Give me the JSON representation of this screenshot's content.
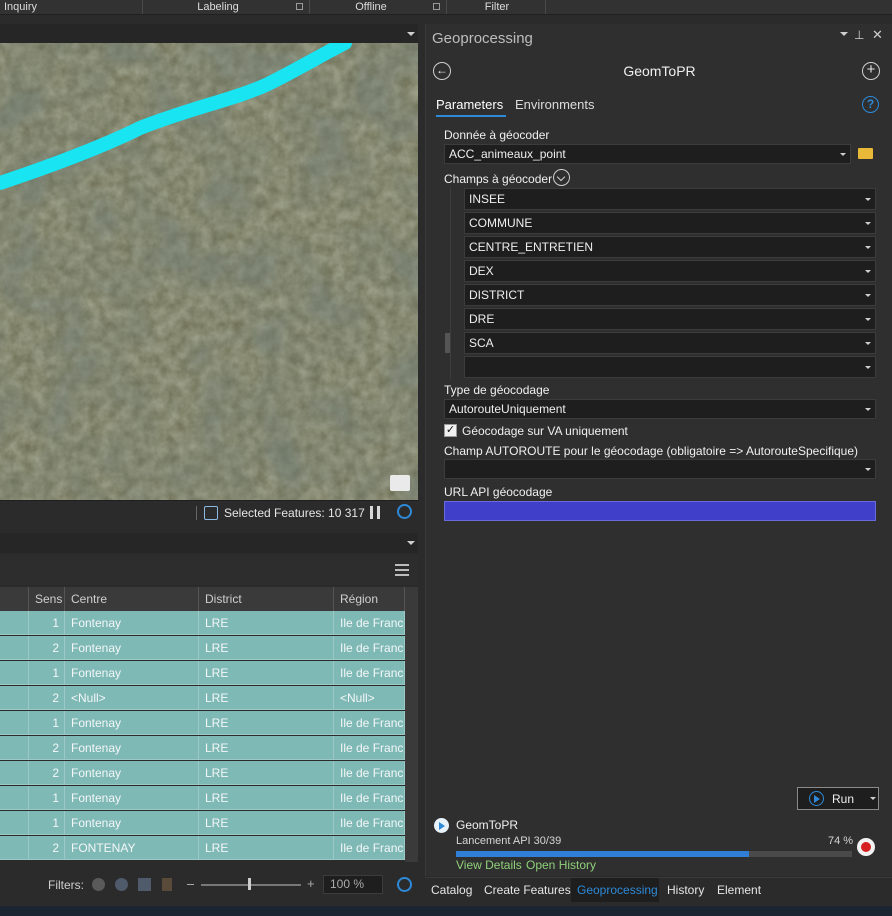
{
  "ribbon": {
    "groups": [
      "Inquiry",
      "Labeling",
      "Offline",
      "Filter"
    ]
  },
  "map": {
    "status": {
      "selected_features": "Selected Features: 10 317"
    }
  },
  "table": {
    "columns": [
      "Sens",
      "Centre",
      "District",
      "Région"
    ],
    "rows": [
      {
        "sens": "1",
        "centre": "Fontenay",
        "district": "LRE",
        "region": "Ile de France"
      },
      {
        "sens": "2",
        "centre": "Fontenay",
        "district": "LRE",
        "region": "Ile de France"
      },
      {
        "sens": "1",
        "centre": "Fontenay",
        "district": "LRE",
        "region": "Ile de France"
      },
      {
        "sens": "2",
        "centre": "<Null>",
        "district": "LRE",
        "region": "<Null>"
      },
      {
        "sens": "1",
        "centre": "Fontenay",
        "district": "LRE",
        "region": "Ile de France"
      },
      {
        "sens": "2",
        "centre": "Fontenay",
        "district": "LRE",
        "region": "Ile de France"
      },
      {
        "sens": "2",
        "centre": "Fontenay",
        "district": "LRE",
        "region": "Ile de France"
      },
      {
        "sens": "1",
        "centre": "Fontenay",
        "district": "LRE",
        "region": "Ile de France"
      },
      {
        "sens": "1",
        "centre": "Fontenay",
        "district": "LRE",
        "region": "Ile de France"
      },
      {
        "sens": "2",
        "centre": "FONTENAY",
        "district": "LRE",
        "region": "Ile de France"
      }
    ],
    "filters_label": "Filters:",
    "zoom": "100 %"
  },
  "gp": {
    "pane_title": "Geoprocessing",
    "tool_title": "GeomToPR",
    "tabs": {
      "parameters": "Parameters",
      "environments": "Environments"
    },
    "donnee_label": "Donnée à géocoder",
    "donnee_value": "ACC_animeaux_point",
    "champs_label": "Champs à géocoder",
    "fields": [
      "INSEE",
      "COMMUNE",
      "CENTRE_ENTRETIEN",
      "DEX",
      "DISTRICT",
      "DRE",
      "SCA",
      ""
    ],
    "type_label": "Type de géocodage",
    "type_value": "AutorouteUniquement",
    "va_label": "Géocodage sur VA uniquement",
    "va_checked": true,
    "autoroute_label": "Champ AUTOROUTE pour le géocodage (obligatoire => AutorouteSpecifique)",
    "autoroute_value": "",
    "url_label": "URL API géocodage",
    "url_value": "",
    "run_label": "Run",
    "progress": {
      "tool": "GeomToPR",
      "message": "Lancement API 30/39",
      "percent_label": "74 %",
      "fraction": 0.74,
      "view_details": "View Details",
      "open_history": "Open History"
    }
  },
  "bottom_tabs": [
    "Catalog",
    "Create Features",
    "Geoprocessing",
    "History",
    "Element"
  ],
  "active_bottom_tab": "Geoprocessing",
  "colors": {
    "accent": "#2e8ad8",
    "row_highlight": "#7fb9b6",
    "route": "#18e4f2",
    "url_field": "#3f3fc9",
    "progress": "#2f7fd6",
    "stop": "#d61f1f",
    "link": "#8fd07a"
  }
}
